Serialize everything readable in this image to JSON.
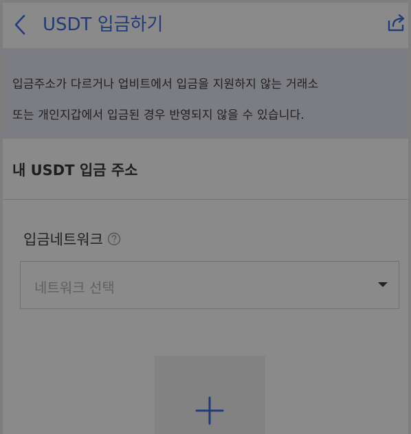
{
  "header": {
    "title": "USDT 입금하기",
    "back_icon": "chevron-left-icon",
    "share_icon": "share-icon",
    "accent_color": "#223a78"
  },
  "notice": {
    "line1": "입금주소가 다르거나 업비트에서 입금을 지원하지 않는 거래소",
    "line2": "또는 개인지갑에서 입금된 경우 반영되지 않을 수 있습니다."
  },
  "address_section": {
    "title": "내 USDT 입금 주소"
  },
  "network": {
    "label": "입금네트워크",
    "help_icon": "question-circle-icon",
    "placeholder": "네트워크 선택",
    "caret_icon": "caret-down-icon"
  },
  "add_tile": {
    "icon": "plus-icon"
  }
}
